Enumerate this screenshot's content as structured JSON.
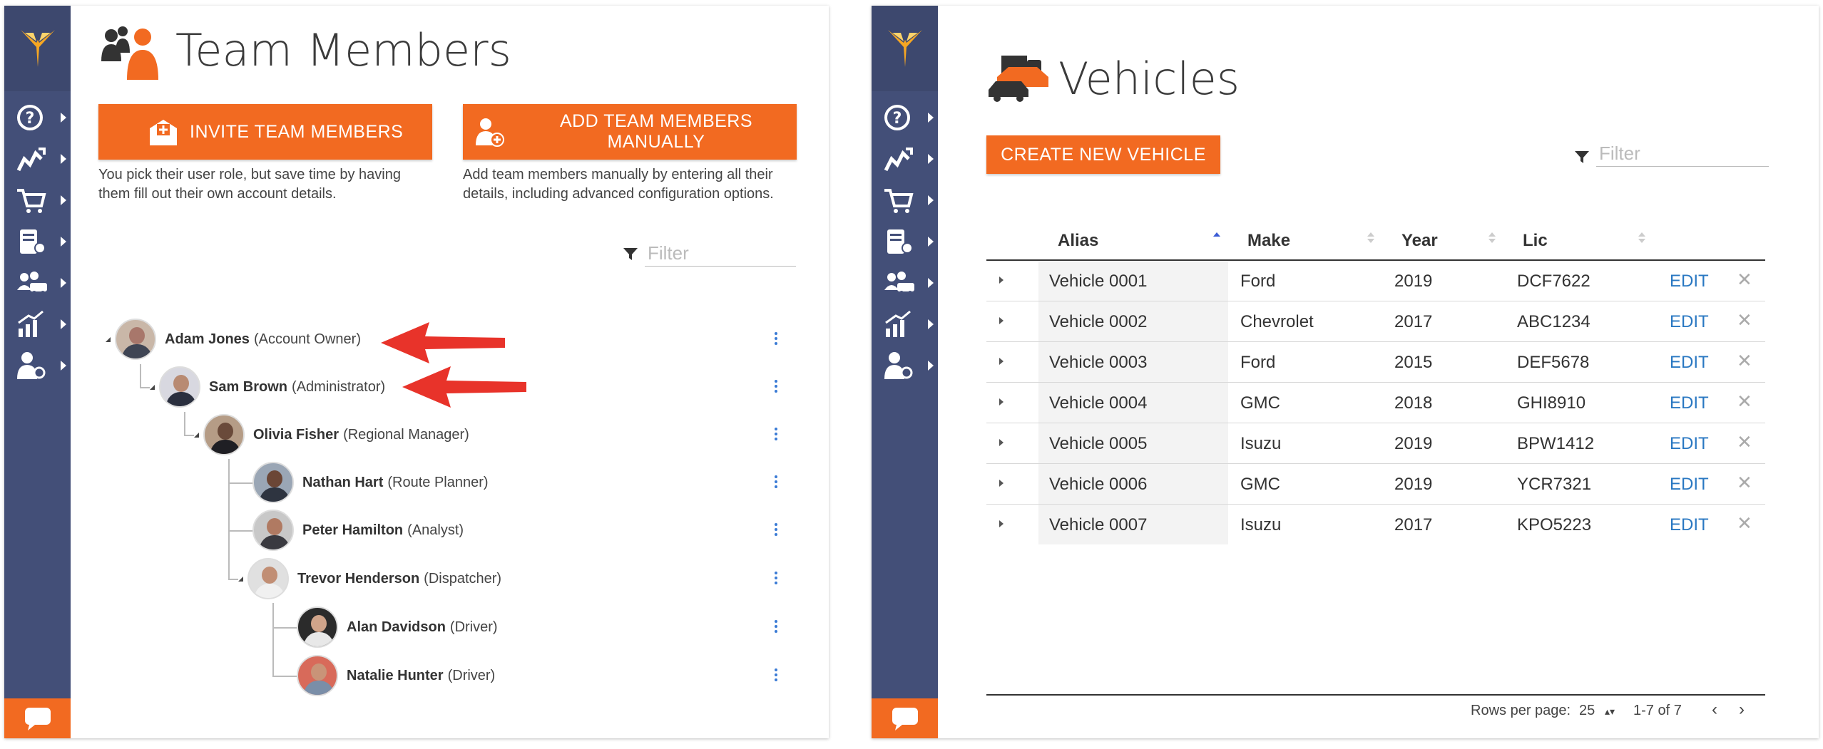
{
  "left": {
    "title": "Team Members",
    "invite_button": "INVITE TEAM MEMBERS",
    "add_manual_button": "ADD TEAM MEMBERS MANUALLY",
    "invite_desc": "You pick their user role, but save time by having them fill out their own account details.",
    "add_manual_desc": "Add team members manually by entering all their details, including advanced configuration options.",
    "filter_placeholder": "Filter",
    "members": [
      {
        "name": "Adam Jones",
        "role": "(Account Owner)"
      },
      {
        "name": "Sam Brown",
        "role": "(Administrator)"
      },
      {
        "name": "Olivia Fisher",
        "role": "(Regional Manager)"
      },
      {
        "name": "Nathan Hart",
        "role": "(Route Planner)"
      },
      {
        "name": "Peter Hamilton",
        "role": "(Analyst)"
      },
      {
        "name": "Trevor Henderson",
        "role": "(Dispatcher)"
      },
      {
        "name": "Alan Davidson",
        "role": "(Driver)"
      },
      {
        "name": "Natalie Hunter",
        "role": "(Driver)"
      }
    ]
  },
  "right": {
    "title": "Vehicles",
    "create_button": "CREATE NEW VEHICLE",
    "filter_placeholder": "Filter",
    "columns": [
      "Alias",
      "Make",
      "Year",
      "Lic"
    ],
    "rows": [
      {
        "alias": "Vehicle 0001",
        "make": "Ford",
        "year": "2019",
        "lic": "DCF7622",
        "edit": "EDIT"
      },
      {
        "alias": "Vehicle 0002",
        "make": "Chevrolet",
        "year": "2017",
        "lic": "ABC1234",
        "edit": "EDIT"
      },
      {
        "alias": "Vehicle 0003",
        "make": "Ford",
        "year": "2015",
        "lic": "DEF5678",
        "edit": "EDIT"
      },
      {
        "alias": "Vehicle 0004",
        "make": "GMC",
        "year": "2018",
        "lic": "GHI8910",
        "edit": "EDIT"
      },
      {
        "alias": "Vehicle 0005",
        "make": "Isuzu",
        "year": "2019",
        "lic": "BPW1412",
        "edit": "EDIT"
      },
      {
        "alias": "Vehicle 0006",
        "make": "GMC",
        "year": "2019",
        "lic": "YCR7321",
        "edit": "EDIT"
      },
      {
        "alias": "Vehicle 0007",
        "make": "Isuzu",
        "year": "2017",
        "lic": "KPO5223",
        "edit": "EDIT"
      }
    ],
    "pager": {
      "rows_per_page_label": "Rows per page:",
      "rows_per_page_value": "25",
      "range": "1-7 of 7",
      "prev": "‹",
      "next": "›"
    }
  },
  "sidebar": {
    "icons": [
      "help-icon",
      "route-icon",
      "cart-icon",
      "route-book-icon",
      "fleet-icon",
      "analytics-icon",
      "user-settings-icon",
      "chat-icon"
    ]
  },
  "colors": {
    "accent": "#f26a21",
    "sidebar": "#434f78",
    "link": "#2a78c2",
    "arrow": "#e8332a"
  }
}
